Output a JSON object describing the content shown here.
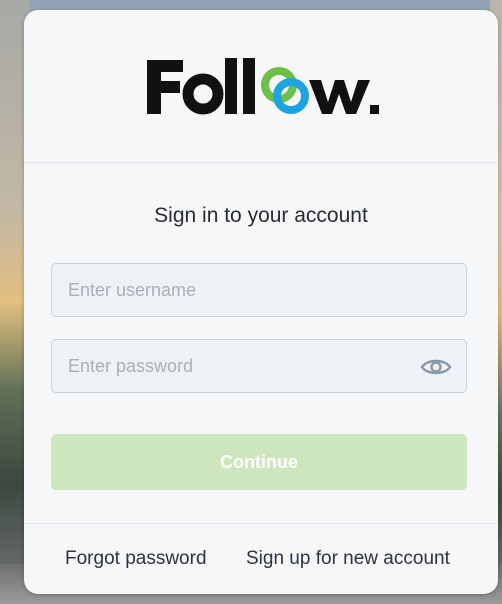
{
  "brand": {
    "logo_text": "Follow.",
    "colors": {
      "wordmark": "#111111",
      "ring_green": "#6cc04a",
      "ring_blue": "#1fa3e0"
    }
  },
  "form": {
    "title": "Sign in to your account",
    "username": {
      "placeholder": "Enter username",
      "value": ""
    },
    "password": {
      "placeholder": "Enter password",
      "value": "",
      "toggle_icon": "eye-icon"
    },
    "continue_label": "Continue",
    "continue_color": "#cde6bd"
  },
  "footer": {
    "forgot_label": "Forgot password",
    "signup_label": "Sign up for new account"
  }
}
